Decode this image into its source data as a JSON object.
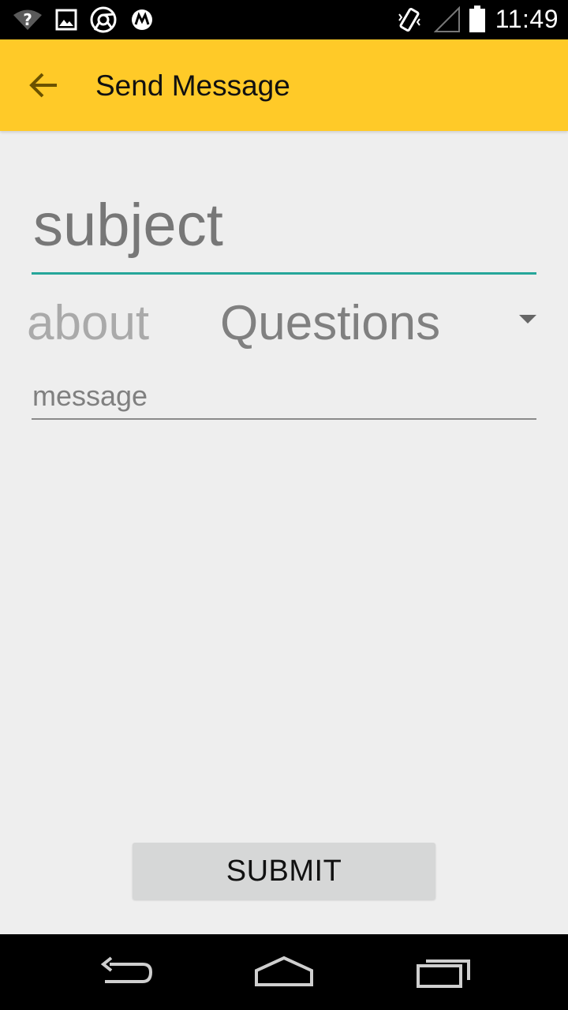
{
  "status_bar": {
    "time": "11:49",
    "icons": [
      "wifi-unknown-icon",
      "image-icon",
      "chrome-icon",
      "motorola-icon",
      "vibrate-icon",
      "signal-icon",
      "battery-icon"
    ]
  },
  "app_bar": {
    "back_icon": "arrow-back-icon",
    "title": "Send Message",
    "color": "#ffca28"
  },
  "form": {
    "subject_placeholder": "subject",
    "about_label": "about",
    "about_selected": "Questions",
    "message_placeholder": "message",
    "accent_color": "#26a69a"
  },
  "submit_label": "SUBMIT",
  "nav_bar": {
    "icons": [
      "back-nav-icon",
      "home-nav-icon",
      "recents-nav-icon"
    ]
  }
}
